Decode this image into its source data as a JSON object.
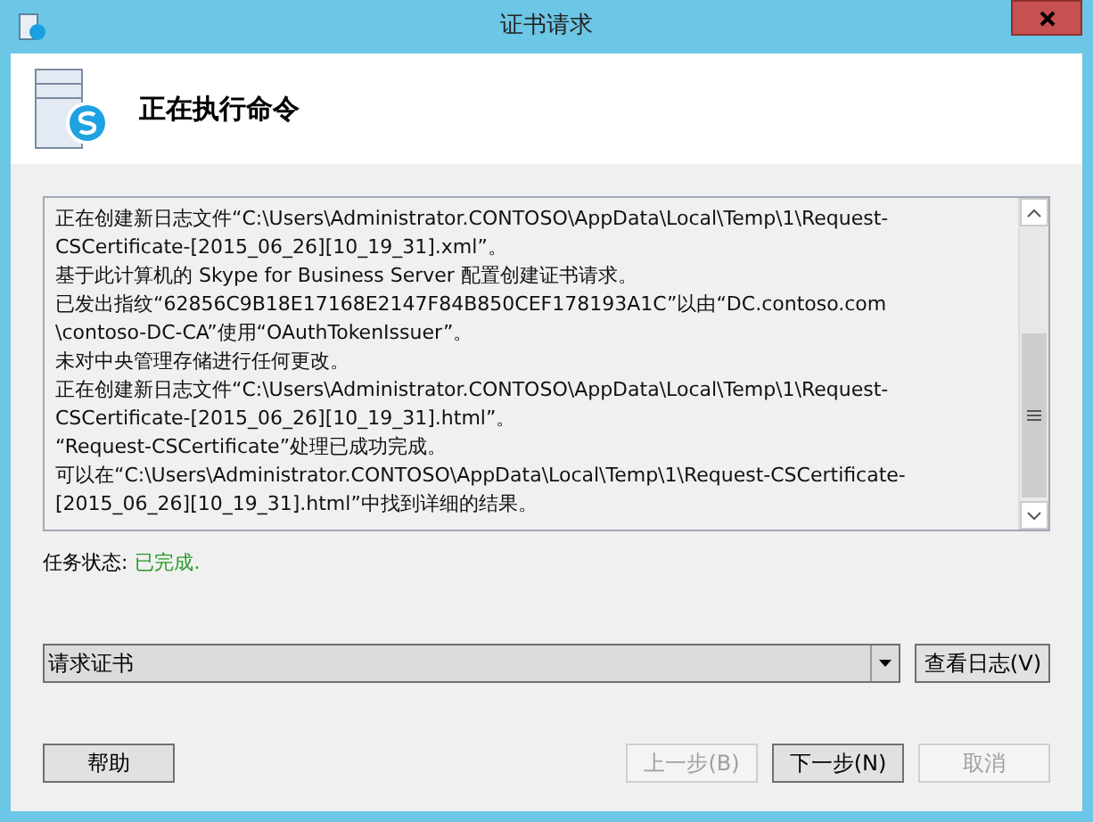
{
  "window": {
    "title": "证书请求"
  },
  "header": {
    "title": "正在执行命令"
  },
  "log": {
    "lines": [
      "正在创建新日志文件“C:\\Users\\Administrator.CONTOSO\\AppData\\Local\\Temp\\1\\Request-",
      "CSCertificate-[2015_06_26][10_19_31].xml”。",
      "基于此计算机的 Skype for Business Server 配置创建证书请求。",
      "已发出指纹“62856C9B18E17168E2147F84B850CEF178193A1C”以由“DC.contoso.com",
      "\\contoso-DC-CA”使用“OAuthTokenIssuer”。",
      "未对中央管理存储进行任何更改。",
      "正在创建新日志文件“C:\\Users\\Administrator.CONTOSO\\AppData\\Local\\Temp\\1\\Request-",
      "CSCertificate-[2015_06_26][10_19_31].html”。",
      "“Request-CSCertificate”处理已成功完成。",
      "可以在“C:\\Users\\Administrator.CONTOSO\\AppData\\Local\\Temp\\1\\Request-CSCertificate-",
      "[2015_06_26][10_19_31].html”中找到详细的结果。"
    ]
  },
  "status": {
    "label": "任务状态:",
    "value": "已完成."
  },
  "task_select": {
    "value": "请求证书"
  },
  "view_log_button": {
    "label": "查看日志(V)",
    "disabled": false
  },
  "help_button": {
    "label": "帮助",
    "disabled": false
  },
  "nav_buttons": [
    {
      "label": "上一步(B)",
      "disabled": true
    },
    {
      "label": "下一步(N)",
      "disabled": false
    },
    {
      "label": "取消",
      "disabled": true
    }
  ]
}
